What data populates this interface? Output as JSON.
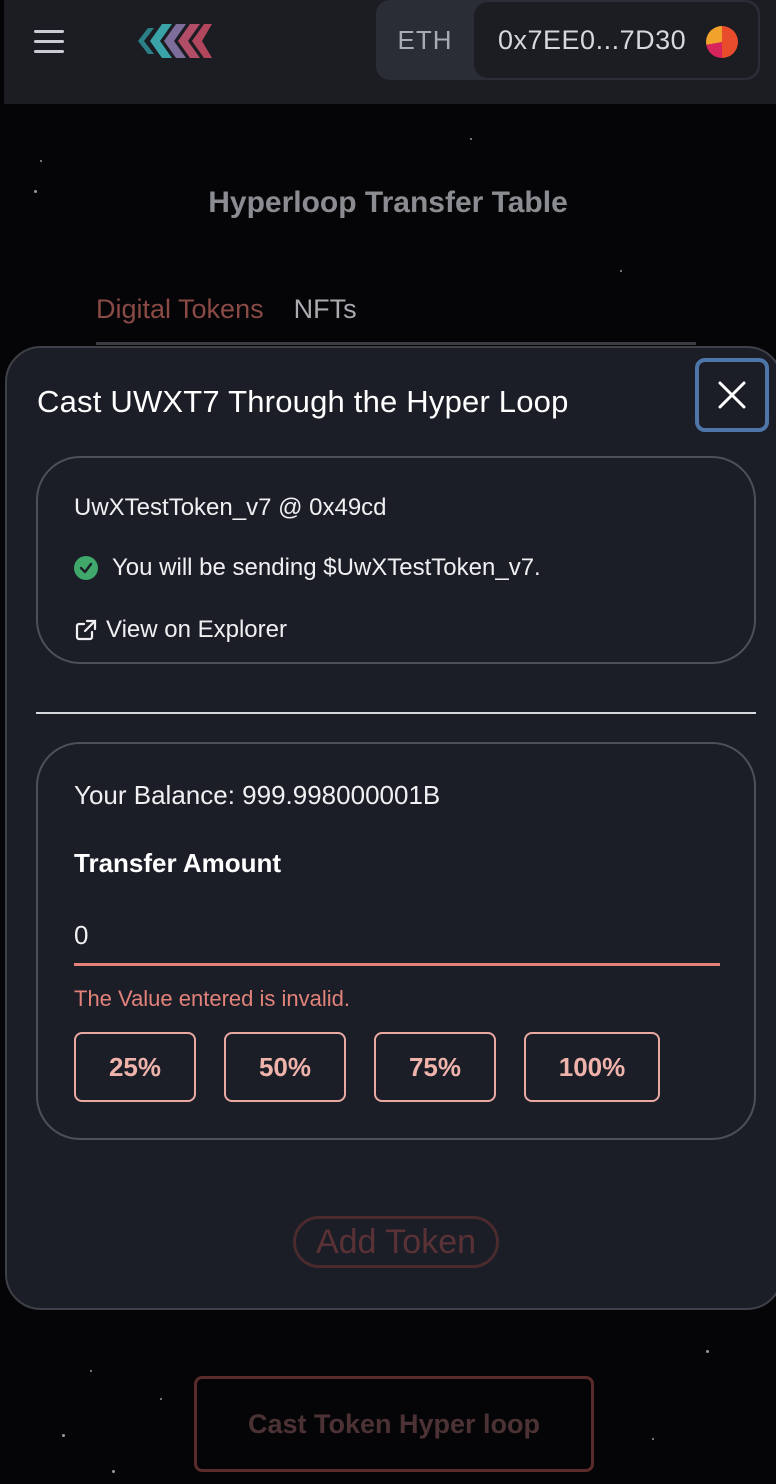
{
  "header": {
    "network": "ETH",
    "wallet_address": "0x7EE0...7D30"
  },
  "page": {
    "title": "Hyperloop Transfer Table",
    "tabs": [
      {
        "label": "Digital Tokens",
        "active": true
      },
      {
        "label": "NFTs",
        "active": false
      }
    ],
    "cast_button": "Cast Token Hyper loop"
  },
  "modal": {
    "title": "Cast UWXT7 Through the Hyper Loop",
    "token_info": {
      "token_line": "UwXTestToken_v7 @ 0x49cd",
      "sending_message": "You will be sending $UwXTestToken_v7.",
      "explorer_link": "View on Explorer"
    },
    "transfer": {
      "balance": "Your Balance: 999.998000001B",
      "amount_label": "Transfer Amount",
      "amount_value": "0",
      "error": "The Value entered is invalid.",
      "percent_buttons": [
        "25%",
        "50%",
        "75%",
        "100%"
      ]
    },
    "add_token": "Add Token"
  },
  "colors": {
    "accent_error": "#e2827a",
    "close_focus": "#4f76a8",
    "success": "#3fa86a"
  }
}
